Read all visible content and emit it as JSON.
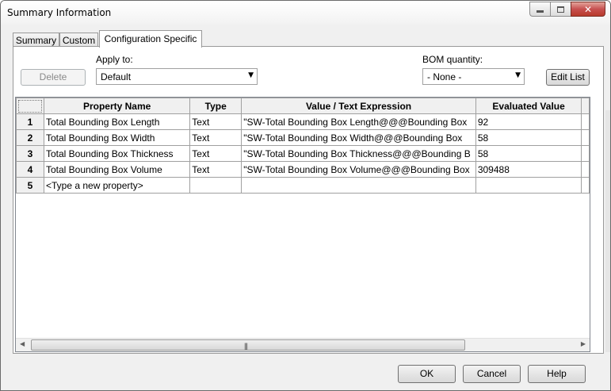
{
  "window": {
    "title": "Summary Information",
    "close_glyph": "✕"
  },
  "tabs": [
    {
      "label": "Summary"
    },
    {
      "label": "Custom"
    },
    {
      "label": "Configuration Specific",
      "active": true
    }
  ],
  "toolbar": {
    "delete_label": "Delete",
    "apply_to_label": "Apply to:",
    "apply_to_value": "Default",
    "bom_quantity_label": "BOM quantity:",
    "bom_quantity_value": "- None -",
    "edit_list_label": "Edit List"
  },
  "grid": {
    "headers": [
      "Property Name",
      "Type",
      "Value / Text Expression",
      "Evaluated Value"
    ],
    "rows": [
      {
        "num": "1",
        "name": "Total Bounding Box Length",
        "type": "Text",
        "value": "\"SW-Total Bounding Box Length@@@Bounding Box",
        "evaluated": "92"
      },
      {
        "num": "2",
        "name": "Total Bounding Box Width",
        "type": "Text",
        "value": "\"SW-Total Bounding Box Width@@@Bounding Box",
        "evaluated": "58"
      },
      {
        "num": "3",
        "name": "Total Bounding Box Thickness",
        "type": "Text",
        "value": "\"SW-Total Bounding Box Thickness@@@Bounding B",
        "evaluated": "58"
      },
      {
        "num": "4",
        "name": "Total Bounding Box Volume",
        "type": "Text",
        "value": "\"SW-Total Bounding Box Volume@@@Bounding Box",
        "evaluated": "309488"
      },
      {
        "num": "5",
        "name": "<Type a new property>",
        "type": "",
        "value": "",
        "evaluated": ""
      }
    ]
  },
  "scrollbar": {
    "left_arrow": "◀",
    "right_arrow": "▶",
    "grip": "|||"
  },
  "footer": {
    "ok_label": "OK",
    "cancel_label": "Cancel",
    "help_label": "Help"
  },
  "icons": {
    "dropdown": "▼"
  }
}
